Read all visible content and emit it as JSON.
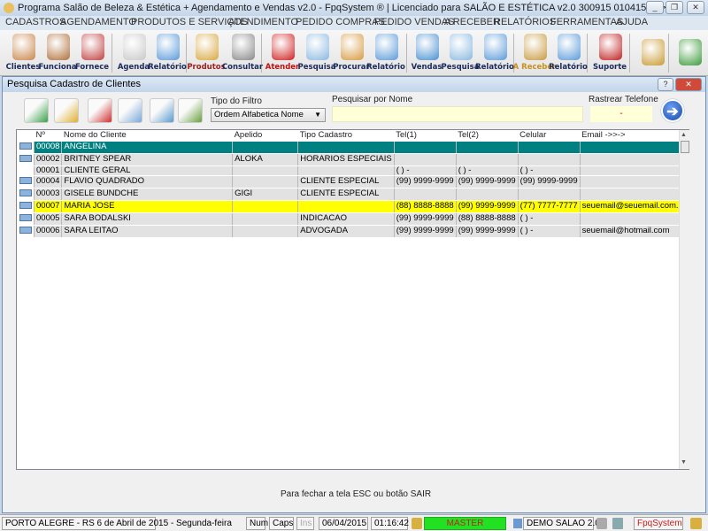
{
  "window": {
    "title": "Programa Salão de Beleza & Estética + Agendamento e Vendas v2.0 - FpqSystem ® | Licenciado para  SALÃO E ESTÉTICA v2.0 300915 010415 >>>",
    "min": "_",
    "max": "❐",
    "close": "✕"
  },
  "menu": [
    "CADASTROS",
    "AGENDAMENTO",
    "PRODUTOS E SERVIÇOS",
    "ATENDIMENTO",
    "PEDIDO COMPRAS",
    "PEDIDO VENDAS",
    "A RECEBER",
    "RELATÓRIOS",
    "FERRAMENTAS",
    "AJUDA"
  ],
  "toolbar": [
    {
      "label": "Clientes",
      "icon": "people-icon",
      "color": "#c8864a"
    },
    {
      "label": "Funciona",
      "icon": "employee-icon",
      "color": "#b0703a"
    },
    {
      "label": "Fornece",
      "icon": "supplier-icon",
      "color": "#c04040"
    },
    {
      "label": "Agenda",
      "icon": "clock-icon",
      "color": "#c8c8c8"
    },
    {
      "label": "Relatório",
      "icon": "printer-icon",
      "color": "#5a9ad8"
    },
    {
      "label": "Produtos",
      "icon": "boxes-icon",
      "color": "#d8a840",
      "labelColor": "#a02020"
    },
    {
      "label": "Consultar",
      "icon": "barcode-icon",
      "color": "#888888"
    },
    {
      "label": "Atender",
      "icon": "scissors-icon",
      "color": "#d02020",
      "labelColor": "#c01010"
    },
    {
      "label": "Pesquisa",
      "icon": "magnifier-icon",
      "color": "#8ab8e0"
    },
    {
      "label": "Procurar",
      "icon": "drawer-icon",
      "color": "#d89a40"
    },
    {
      "label": "Relatório",
      "icon": "printer-icon",
      "color": "#5a9ad8"
    },
    {
      "label": "Vendas",
      "icon": "monitor-icon",
      "color": "#4a90d0"
    },
    {
      "label": "Pesquisa",
      "icon": "magnifier-icon",
      "color": "#8ab8e0"
    },
    {
      "label": "Relatório",
      "icon": "printer-icon",
      "color": "#5a9ad8"
    },
    {
      "label": "A Receber",
      "icon": "money-icon",
      "color": "#c89a40",
      "labelColor": "#c89020"
    },
    {
      "label": "Relatório",
      "icon": "printer-icon",
      "color": "#5a9ad8"
    },
    {
      "label": "Suporte",
      "icon": "support-icon",
      "color": "#c02020"
    },
    {
      "label": "",
      "icon": "coin-icon",
      "color": "#c89a30"
    },
    {
      "label": "",
      "icon": "exit-icon",
      "color": "#3a9a3a"
    }
  ],
  "dialog": {
    "title": "Pesquisa Cadastro de Clientes",
    "help": "?",
    "close": "✕",
    "actions": [
      {
        "icon": "add-document-icon",
        "color": "#3aa04a"
      },
      {
        "icon": "edit-document-icon",
        "color": "#e0b030"
      },
      {
        "icon": "delete-document-icon",
        "color": "#d03030"
      },
      {
        "icon": "print-icon",
        "color": "#7aa8d8"
      },
      {
        "icon": "image-icon",
        "color": "#5a9ad0"
      },
      {
        "icon": "report-icon",
        "color": "#6aa040"
      }
    ],
    "filter_label": "Tipo do Filtro",
    "filter_value": "Ordem Alfabetica Nome",
    "search_label": "Pesquisar por Nome",
    "search_value": "",
    "phone_label": "Rastrear Telefone",
    "phone_value": "-",
    "go_icon": "arrow-right-icon",
    "columns": [
      "Nº",
      "Nome do Cliente",
      "Apelido",
      "Tipo Cadastro",
      "Tel(1)",
      "Tel(2)",
      "Celular",
      "Email ->>->"
    ],
    "rows": [
      {
        "state": "selected",
        "icon": true,
        "cells": [
          "00008",
          "ANGELINA",
          "",
          "",
          "",
          "",
          "",
          ""
        ]
      },
      {
        "state": "",
        "icon": true,
        "cells": [
          "00002",
          "BRITNEY SPEAR",
          "ALOKA",
          "HORARIOS ESPECIAIS",
          "",
          "",
          "",
          ""
        ]
      },
      {
        "state": "",
        "icon": false,
        "cells": [
          "00001",
          "CLIENTE GERAL",
          "",
          "",
          "(  )    -",
          "(  )    -",
          "(  )    -",
          ""
        ]
      },
      {
        "state": "",
        "icon": true,
        "cells": [
          "00004",
          "FLAVIO QUADRADO",
          "",
          "CLIENTE ESPECIAL",
          "(99) 9999-9999",
          "(99) 9999-9999",
          "(99) 9999-9999",
          ""
        ]
      },
      {
        "state": "",
        "icon": true,
        "cells": [
          "00003",
          "GISELE BUNDCHE",
          "GIGI",
          "CLIENTE ESPECIAL",
          "",
          "",
          "",
          ""
        ]
      },
      {
        "state": "highlight",
        "icon": true,
        "cells": [
          "00007",
          "MARIA JOSE",
          "",
          "",
          "(88) 8888-8888",
          "(99) 9999-9999",
          "(77) 7777-7777",
          "seuemail@seuemail.com.br"
        ]
      },
      {
        "state": "",
        "icon": true,
        "cells": [
          "00005",
          "SARA BODALSKI",
          "",
          "INDICACAO",
          "(99) 9999-9999",
          "(88) 8888-8888",
          "(  )    -",
          ""
        ]
      },
      {
        "state": "",
        "icon": true,
        "cells": [
          "00006",
          "SARA LEITAO",
          "",
          "ADVOGADA",
          "(99) 9999-9999",
          "(99) 9999-9999",
          "(  )    -",
          "seuemail@hotmail.com"
        ]
      }
    ],
    "footer": "Para fechar a tela ESC ou botão SAIR"
  },
  "status": {
    "location": "PORTO ALEGRE - RS  6 de Abril de 2015 - Segunda-feira",
    "num": "Num",
    "caps": "Caps",
    "ins": "Ins",
    "date": "06/04/2015",
    "time": "01:16:42",
    "user": "MASTER",
    "company": "DEMO SALAO 2.0",
    "brand": "FpqSystem",
    "user_color": "#22e022"
  }
}
